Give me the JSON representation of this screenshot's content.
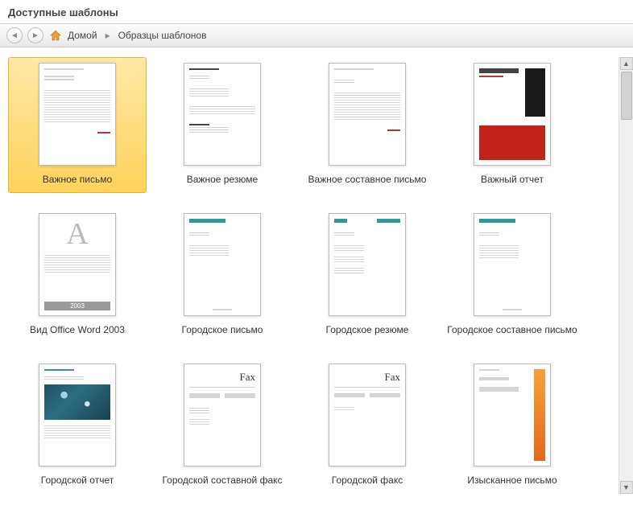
{
  "panel_title": "Доступные шаблоны",
  "breadcrumb": {
    "home": "Домой",
    "current": "Образцы шаблонов"
  },
  "templates": [
    {
      "label": "Важное письмо",
      "selected": true,
      "thumb": "letter-red"
    },
    {
      "label": "Важное резюме",
      "selected": false,
      "thumb": "resume-red"
    },
    {
      "label": "Важное составное письмо",
      "selected": false,
      "thumb": "merge-red"
    },
    {
      "label": "Важный отчет",
      "selected": false,
      "thumb": "report-red-black"
    },
    {
      "label": "Вид Office Word 2003",
      "selected": false,
      "thumb": "word2003"
    },
    {
      "label": "Городское письмо",
      "selected": false,
      "thumb": "letter-teal"
    },
    {
      "label": "Городское резюме",
      "selected": false,
      "thumb": "resume-teal"
    },
    {
      "label": "Городское составное письмо",
      "selected": false,
      "thumb": "merge-teal"
    },
    {
      "label": "Городской отчет",
      "selected": false,
      "thumb": "report-teal-photo"
    },
    {
      "label": "Городской составной факс",
      "selected": false,
      "thumb": "fax-compound"
    },
    {
      "label": "Городской факс",
      "selected": false,
      "thumb": "fax"
    },
    {
      "label": "Изысканное письмо",
      "selected": false,
      "thumb": "letter-orange"
    }
  ],
  "misc": {
    "fax_word": "Fax",
    "badge_2003": "2003"
  }
}
